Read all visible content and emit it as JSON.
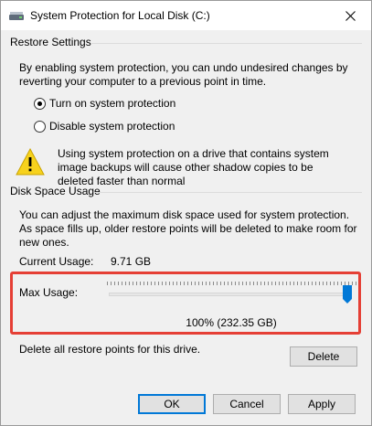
{
  "window": {
    "title": "System Protection for Local Disk (C:)",
    "icon": "drive-icon",
    "close_icon": "close-icon"
  },
  "restore_settings": {
    "heading": "Restore Settings",
    "description": "By enabling system protection, you can undo undesired changes by reverting your computer to a previous point in time.",
    "options": [
      {
        "label": "Turn on system protection",
        "checked": true
      },
      {
        "label": "Disable system protection",
        "checked": false
      }
    ],
    "warning": "Using system protection on a drive that contains system image backups will cause other shadow copies to be deleted faster than normal"
  },
  "disk_space": {
    "heading": "Disk Space Usage",
    "description": "You can adjust the maximum disk space used for system protection. As space fills up, older restore points will be deleted to make room for new ones.",
    "current_usage_label": "Current Usage:",
    "current_usage_value": "9.71 GB",
    "max_usage_label": "Max Usage:",
    "max_usage_percent": 100,
    "max_usage_text": "100% (232.35 GB)",
    "delete_text": "Delete all restore points for this drive.",
    "delete_button": "Delete"
  },
  "footer": {
    "ok": "OK",
    "cancel": "Cancel",
    "apply": "Apply"
  },
  "colors": {
    "highlight": "#e53f35",
    "default_button_border": "#0078d7",
    "slider_thumb": "#0078d7",
    "warning_fill": "#f7d21d"
  }
}
